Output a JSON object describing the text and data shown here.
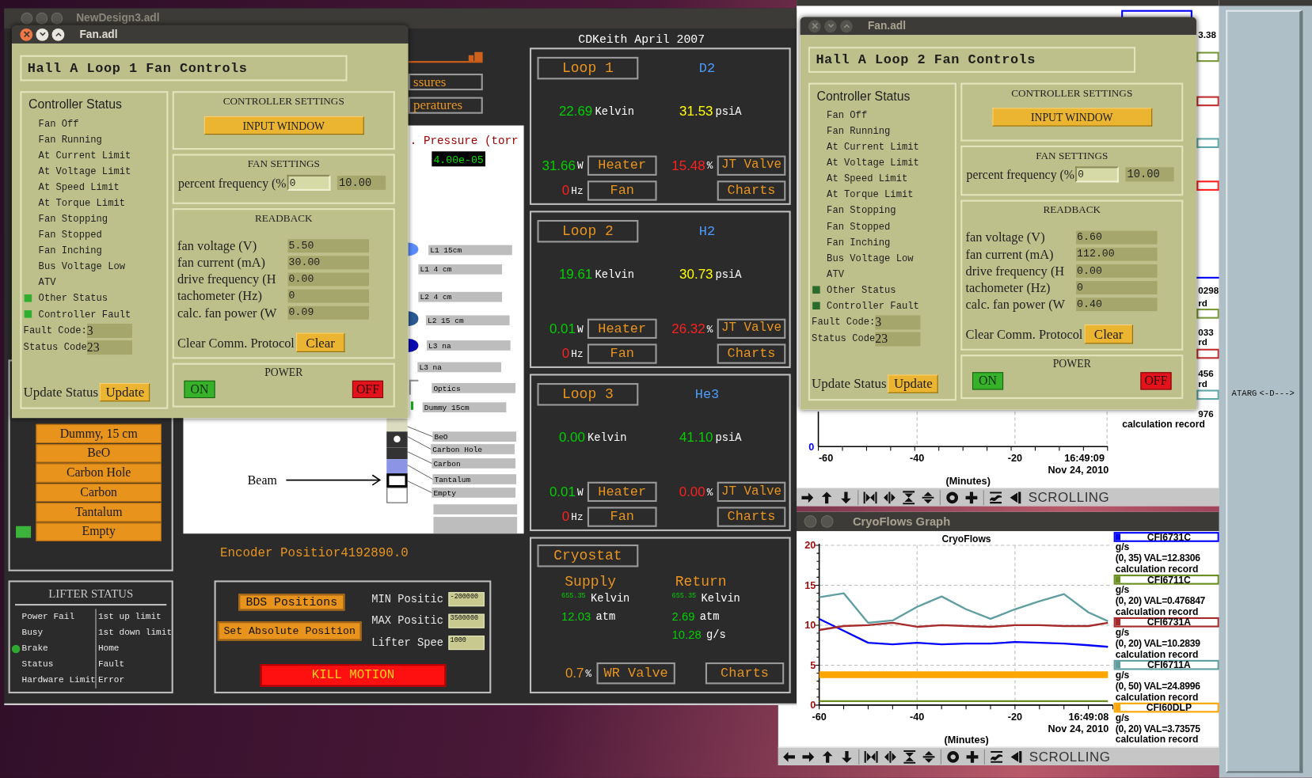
{
  "main_window": {
    "title": "NewDesign3.adl",
    "header": "CDKeith April 2007",
    "nav_buttons": [
      "ssures",
      "peratures"
    ],
    "pressure": {
      "label": ". Pressure (torr",
      "value": "4.00e-05"
    },
    "target_labels": [
      "L1 15cm",
      "L1 4 cm",
      "L2 4 cm",
      "L2 15 cm",
      "L3 na",
      "L3 na",
      "Optics",
      "Dummy 15cm",
      "BeO",
      "Carbon Hole",
      "Carbon",
      "Tantalum",
      "Empty"
    ],
    "beam_label": "Beam",
    "target_buttons": [
      {
        "label": "Dummy, 15 cm",
        "selected": false
      },
      {
        "label": "BeO",
        "selected": false
      },
      {
        "label": "Carbon Hole",
        "selected": false
      },
      {
        "label": "Carbon",
        "selected": false
      },
      {
        "label": "Tantalum",
        "selected": false
      },
      {
        "label": "Empty",
        "selected": true
      }
    ],
    "encoder": {
      "label": "Encoder Positior",
      "value": "4192890.0"
    },
    "lifter_status": {
      "title": "LIFTER STATUS",
      "left": [
        {
          "label": "Power Fail",
          "on": false
        },
        {
          "label": "Busy",
          "on": false
        },
        {
          "label": "Brake",
          "on": true
        },
        {
          "label": "Status",
          "on": false
        },
        {
          "label": "Hardware Limit",
          "on": false
        }
      ],
      "right": [
        "1st up limit",
        "1st down limit",
        "Home",
        "Fault",
        "Error"
      ]
    },
    "bds": {
      "buttons": [
        "BDS Positions",
        "Set Absolute Position"
      ],
      "fields": [
        {
          "label": "MIN Positic",
          "value": "-200000"
        },
        {
          "label": "MAX Positic",
          "value": "3500000"
        },
        {
          "label": "Lifter Spee",
          "value": "1000"
        }
      ],
      "kill_button": "KILL MOTION"
    },
    "loops": [
      {
        "name": "Loop 1",
        "gas": "D2",
        "temperature": "22.69",
        "temp_unit": "Kelvin",
        "pressure": "31.53",
        "pressure_unit": "psiA",
        "pressure_alarm": true,
        "heater_power": "31.66",
        "power_unit": "W",
        "heater_button": "Heater",
        "valve": "15.48",
        "valve_unit": "%",
        "valve_button": "JT Valve",
        "fan_freq": "0",
        "freq_unit": "Hz",
        "fan_button": "Fan",
        "charts_button": "Charts"
      },
      {
        "name": "Loop 2",
        "gas": "H2",
        "temperature": "19.61",
        "temp_unit": "Kelvin",
        "pressure": "30.73",
        "pressure_unit": "psiA",
        "pressure_alarm": true,
        "heater_power": "0.01",
        "power_unit": "W",
        "heater_button": "Heater",
        "valve": "26.32",
        "valve_unit": "%",
        "valve_button": "JT Valve",
        "fan_freq": "0",
        "freq_unit": "Hz",
        "fan_button": "Fan",
        "charts_button": "Charts"
      },
      {
        "name": "Loop 3",
        "gas": "He3",
        "temperature": "0.00",
        "temp_unit": "Kelvin",
        "pressure": "41.10",
        "pressure_unit": "psiA",
        "pressure_alarm": false,
        "heater_power": "0.01",
        "power_unit": "W",
        "heater_button": "Heater",
        "valve": "0.00",
        "valve_unit": "%",
        "valve_button": "JT Valve",
        "fan_freq": "0",
        "freq_unit": "Hz",
        "fan_button": "Fan",
        "charts_button": "Charts"
      }
    ],
    "cryostat": {
      "name": "Cryostat",
      "supply": {
        "label": "Supply",
        "temperature": "655.35",
        "temp_unit": "Kelvin",
        "pressure": "12.03",
        "pressure_unit": "atm"
      },
      "return": {
        "label": "Return",
        "temperature": "655.35",
        "temp_unit": "Kelvin",
        "pressure": "2.69",
        "pressure_unit": "atm",
        "flow": "10.28",
        "flow_unit": "g/s"
      },
      "valve": "0.7",
      "valve_unit": "%",
      "valve_button": "WR Valve",
      "charts_button": "Charts"
    }
  },
  "fan_windows": [
    {
      "title": "Fan.adl",
      "focused": true,
      "heading": "Hall A Loop 1 Fan Controls",
      "status_title": "Controller Status",
      "status_items": [
        {
          "label": "Fan Off",
          "on": false
        },
        {
          "label": "Fan Running",
          "on": false
        },
        {
          "label": "At Current Limit",
          "on": false
        },
        {
          "label": "At Voltage Limit",
          "on": false
        },
        {
          "label": "At Speed Limit",
          "on": false
        },
        {
          "label": "At Torque Limit",
          "on": false
        },
        {
          "label": "Fan Stopping",
          "on": false
        },
        {
          "label": "Fan Stopped",
          "on": false
        },
        {
          "label": "Fan Inching",
          "on": false
        },
        {
          "label": "Bus Voltage Low",
          "on": false
        },
        {
          "label": "ATV",
          "on": false
        },
        {
          "label": "Other Status",
          "on": true,
          "color": "#2fae2f"
        },
        {
          "label": "Controller Fault",
          "on": true,
          "color": "#2fae2f"
        }
      ],
      "codes": [
        {
          "label": "Fault Code:",
          "value": "3"
        },
        {
          "label": "Status Code",
          "value": "23"
        }
      ],
      "update_label": "Update Status",
      "update_button": "Update",
      "settings_title": "CONTROLLER SETTINGS",
      "input_button": "INPUT WINDOW",
      "fan_settings_title": "FAN SETTINGS",
      "setpoint": {
        "label": "percent frequency (%",
        "input": "0",
        "readback": "10.00"
      },
      "readback_title": "READBACK",
      "readbacks": [
        {
          "label": "fan voltage (V)",
          "value": "5.50"
        },
        {
          "label": "fan current (mA)",
          "value": "30.00"
        },
        {
          "label": "drive frequency (H",
          "value": "0.00"
        },
        {
          "label": "tachometer (Hz)",
          "value": "0"
        },
        {
          "label": "calc. fan power (W",
          "value": "0.09"
        }
      ],
      "clear_label": "Clear Comm. Protocol",
      "clear_button": "Clear",
      "power_title": "POWER",
      "on_button": "ON",
      "off_button": "OFF"
    },
    {
      "title": "Fan.adl",
      "focused": false,
      "heading": "Hall A Loop 2 Fan Controls",
      "status_title": "Controller Status",
      "status_items": [
        {
          "label": "Fan Off",
          "on": false
        },
        {
          "label": "Fan Running",
          "on": false
        },
        {
          "label": "At Current Limit",
          "on": false
        },
        {
          "label": "At Voltage Limit",
          "on": false
        },
        {
          "label": "At Speed Limit",
          "on": false
        },
        {
          "label": "At Torque Limit",
          "on": false
        },
        {
          "label": "Fan Stopping",
          "on": false
        },
        {
          "label": "Fan Stopped",
          "on": false
        },
        {
          "label": "Fan Inching",
          "on": false
        },
        {
          "label": "Bus Voltage Low",
          "on": false
        },
        {
          "label": "ATV",
          "on": false
        },
        {
          "label": "Other Status",
          "on": true,
          "color": "#2b6b2b"
        },
        {
          "label": "Controller Fault",
          "on": true,
          "color": "#2b6b2b"
        }
      ],
      "codes": [
        {
          "label": "Fault Code:",
          "value": "3"
        },
        {
          "label": "Status Code",
          "value": "23"
        }
      ],
      "update_label": "Update Status",
      "update_button": "Update",
      "settings_title": "CONTROLLER SETTINGS",
      "input_button": "INPUT WINDOW",
      "fan_settings_title": "FAN SETTINGS",
      "setpoint": {
        "label": "percent frequency (%",
        "input": "0",
        "readback": "10.00"
      },
      "readback_title": "READBACK",
      "readbacks": [
        {
          "label": "fan voltage (V)",
          "value": "6.60"
        },
        {
          "label": "fan current (mA)",
          "value": "112.00"
        },
        {
          "label": "drive frequency (H",
          "value": "0.00"
        },
        {
          "label": "tachometer (Hz)",
          "value": "0"
        },
        {
          "label": "calc. fan power (W",
          "value": "0.40"
        }
      ],
      "clear_label": "Clear Comm. Protocol",
      "clear_button": "Clear",
      "power_title": "POWER",
      "on_button": "ON",
      "off_button": "OFF"
    }
  ],
  "cryotemps_graph": {
    "legend_fragments": [
      "3.38",
      "0298",
      "rd",
      "033",
      "rd",
      "456",
      "rd",
      "976"
    ],
    "legend_swatches": [
      {
        "color": "#7a9a3a"
      },
      {
        "color": "#c03030"
      },
      {
        "color": "#5fa8a8"
      },
      {
        "color": "#ff2020"
      },
      {
        "color": "#7a9a3a"
      },
      {
        "color": "#c03030"
      },
      {
        "color": "#5fa8a8"
      }
    ],
    "legend_last": "calculation record",
    "y_tick": "0",
    "x_ticks": [
      "-60",
      "-40",
      "-20"
    ],
    "timestamp": [
      "16:49:09",
      "Nov 24, 2010"
    ],
    "x_title": "(Minutes)",
    "mode": "SCROLLING"
  },
  "cryoflows_graph": {
    "title": "CryoFlows Graph",
    "chart_data": {
      "type": "line",
      "title": "CryoFlows",
      "xlabel": "(Minutes)",
      "x": [
        -60,
        -55,
        -50,
        -45,
        -40,
        -35,
        -30,
        -25,
        -20,
        -15,
        -10,
        -5,
        -1
      ],
      "xlim": [
        -60,
        0
      ],
      "ylim": [
        0,
        20
      ],
      "xticks": [
        -60,
        -40,
        -20
      ],
      "yticks": [
        0,
        5,
        10,
        15,
        20
      ],
      "grid": true,
      "series": [
        {
          "name": "CFI6731C",
          "color": "#0000ff",
          "values": [
            10.8,
            9.3,
            7.8,
            7.6,
            7.8,
            7.6,
            7.7,
            7.7,
            7.9,
            7.8,
            7.7,
            7.5,
            7.3
          ]
        },
        {
          "name": "CFI6711C",
          "color": "#6b8e23",
          "values": [
            0.5,
            0.5,
            0.5,
            0.5,
            0.5,
            0.5,
            0.5,
            0.5,
            0.5,
            0.5,
            0.5,
            0.5,
            0.5
          ]
        },
        {
          "name": "CFI6731A",
          "color": "#a52a2a",
          "values": [
            9.4,
            9.9,
            10.0,
            10.3,
            9.8,
            10.0,
            9.9,
            9.8,
            10.0,
            10.0,
            9.9,
            9.9,
            10.3
          ]
        },
        {
          "name": "CFI6711A",
          "color": "#5f9ea0",
          "values": [
            13.5,
            14.0,
            10.3,
            10.6,
            12.3,
            13.6,
            12.0,
            10.8,
            12.0,
            13.0,
            13.9,
            11.6,
            10.5
          ]
        },
        {
          "name": "CFI60DLP",
          "color": "#ffa500",
          "values": [
            3.8,
            3.8,
            3.8,
            3.8,
            3.8,
            3.8,
            3.8,
            3.8,
            3.8,
            3.8,
            3.8,
            3.8,
            3.8
          ]
        }
      ]
    },
    "timestamp": [
      "16:49:08",
      "Nov 24, 2010"
    ],
    "legend": [
      {
        "units": "g/s",
        "range": "(0, 35) VAL=12.8306",
        "description": "calculation record"
      },
      {
        "units": "g/s",
        "range": "(0, 20) VAL=0.476847",
        "description": "calculation record"
      },
      {
        "units": "g/s",
        "range": "(0, 20) VAL=10.2839",
        "description": "calculation record"
      },
      {
        "units": "g/s",
        "range": "(0, 50) VAL=24.8996",
        "description": "calculation record"
      },
      {
        "units": "g/s",
        "range": "(0, 20) VAL=3.73575",
        "description": "calculation record"
      }
    ],
    "mode": "SCROLLING"
  },
  "atarg_window": {
    "labels": [
      "ATARG",
      "<-D--->"
    ]
  }
}
